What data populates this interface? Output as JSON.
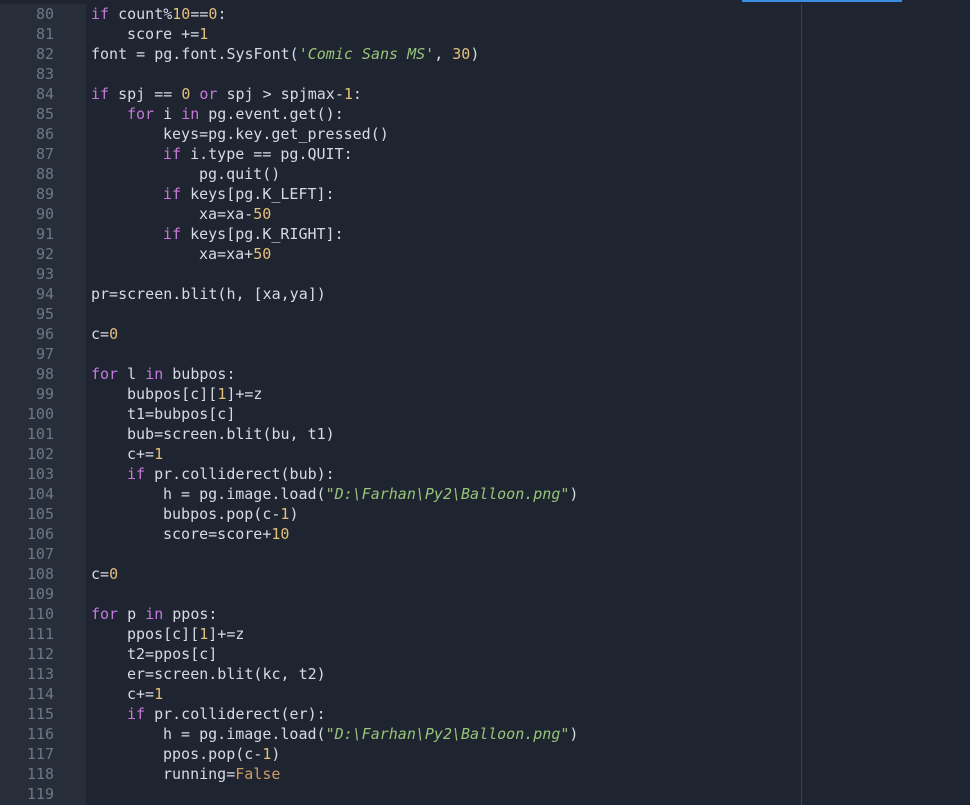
{
  "colors": {
    "background": "#1e2430",
    "gutter": "#272d39",
    "keyword": "#c678dd",
    "number": "#e5c07b",
    "string": "#98c379",
    "text": "#d6dae3",
    "line_number": "#6f7786",
    "accent": "#3a8ee6"
  },
  "editor": {
    "lines": [
      {
        "n": "80",
        "indent": 8,
        "tokens": [
          [
            "kw",
            "if"
          ],
          [
            "t",
            " count%"
          ],
          [
            "num",
            "10"
          ],
          [
            "t",
            "=="
          ],
          [
            "num",
            "0"
          ],
          [
            "t",
            ":"
          ]
        ]
      },
      {
        "n": "81",
        "indent": 12,
        "tokens": [
          [
            "t",
            "score +="
          ],
          [
            "num",
            "1"
          ]
        ]
      },
      {
        "n": "82",
        "indent": 8,
        "tokens": [
          [
            "t",
            "font = pg.font.SysFont("
          ],
          [
            "str",
            "'Comic Sans MS'"
          ],
          [
            "t",
            ", "
          ],
          [
            "num",
            "30"
          ],
          [
            "t",
            ")"
          ]
        ]
      },
      {
        "n": "83",
        "indent": 0,
        "tokens": []
      },
      {
        "n": "84",
        "indent": 8,
        "tokens": [
          [
            "kw",
            "if"
          ],
          [
            "t",
            " spj == "
          ],
          [
            "num",
            "0"
          ],
          [
            "t",
            " "
          ],
          [
            "kw",
            "or"
          ],
          [
            "t",
            " spj > spjmax-"
          ],
          [
            "num",
            "1"
          ],
          [
            "t",
            ":"
          ]
        ]
      },
      {
        "n": "85",
        "indent": 12,
        "tokens": [
          [
            "kw",
            "for"
          ],
          [
            "t",
            " i "
          ],
          [
            "kw",
            "in"
          ],
          [
            "t",
            " pg.event.get():"
          ]
        ]
      },
      {
        "n": "86",
        "indent": 16,
        "tokens": [
          [
            "t",
            "keys=pg.key.get_pressed()"
          ]
        ]
      },
      {
        "n": "87",
        "indent": 16,
        "tokens": [
          [
            "kw",
            "if"
          ],
          [
            "t",
            " i.type == pg.QUIT:"
          ]
        ]
      },
      {
        "n": "88",
        "indent": 20,
        "tokens": [
          [
            "t",
            "pg.quit()"
          ]
        ]
      },
      {
        "n": "89",
        "indent": 16,
        "tokens": [
          [
            "kw",
            "if"
          ],
          [
            "t",
            " keys[pg.K_LEFT]:"
          ]
        ]
      },
      {
        "n": "90",
        "indent": 20,
        "tokens": [
          [
            "t",
            "xa=xa-"
          ],
          [
            "num",
            "50"
          ]
        ]
      },
      {
        "n": "91",
        "indent": 16,
        "tokens": [
          [
            "kw",
            "if"
          ],
          [
            "t",
            " keys[pg.K_RIGHT]:"
          ]
        ]
      },
      {
        "n": "92",
        "indent": 20,
        "tokens": [
          [
            "t",
            "xa=xa+"
          ],
          [
            "num",
            "50"
          ]
        ]
      },
      {
        "n": "93",
        "indent": 0,
        "tokens": []
      },
      {
        "n": "94",
        "indent": 8,
        "tokens": [
          [
            "t",
            "pr=screen.blit(h, [xa,ya])"
          ]
        ]
      },
      {
        "n": "95",
        "indent": 0,
        "tokens": []
      },
      {
        "n": "96",
        "indent": 8,
        "tokens": [
          [
            "t",
            "c="
          ],
          [
            "num",
            "0"
          ]
        ]
      },
      {
        "n": "97",
        "indent": 0,
        "tokens": []
      },
      {
        "n": "98",
        "indent": 8,
        "tokens": [
          [
            "kw",
            "for"
          ],
          [
            "t",
            " l "
          ],
          [
            "kw",
            "in"
          ],
          [
            "t",
            " bubpos:"
          ]
        ]
      },
      {
        "n": "99",
        "indent": 12,
        "tokens": [
          [
            "t",
            "bubpos[c]["
          ],
          [
            "num",
            "1"
          ],
          [
            "t",
            "]+=z"
          ]
        ]
      },
      {
        "n": "100",
        "indent": 12,
        "tokens": [
          [
            "t",
            "t1=bubpos[c]"
          ]
        ]
      },
      {
        "n": "101",
        "indent": 12,
        "tokens": [
          [
            "t",
            "bub=screen.blit(bu, t1)"
          ]
        ]
      },
      {
        "n": "102",
        "indent": 12,
        "tokens": [
          [
            "t",
            "c+="
          ],
          [
            "num",
            "1"
          ]
        ]
      },
      {
        "n": "103",
        "indent": 12,
        "tokens": [
          [
            "kw",
            "if"
          ],
          [
            "t",
            " pr.colliderect(bub):"
          ]
        ]
      },
      {
        "n": "104",
        "indent": 16,
        "tokens": [
          [
            "t",
            "h = pg.image.load("
          ],
          [
            "str",
            "\"D:\\Farhan\\Py2\\Balloon.png\""
          ],
          [
            "t",
            ")"
          ]
        ]
      },
      {
        "n": "105",
        "indent": 16,
        "tokens": [
          [
            "t",
            "bubpos.pop(c-"
          ],
          [
            "num",
            "1"
          ],
          [
            "t",
            ")"
          ]
        ]
      },
      {
        "n": "106",
        "indent": 16,
        "tokens": [
          [
            "t",
            "score=score+"
          ],
          [
            "num",
            "10"
          ]
        ]
      },
      {
        "n": "107",
        "indent": 0,
        "tokens": []
      },
      {
        "n": "108",
        "indent": 8,
        "tokens": [
          [
            "t",
            "c="
          ],
          [
            "num",
            "0"
          ]
        ]
      },
      {
        "n": "109",
        "indent": 0,
        "tokens": []
      },
      {
        "n": "110",
        "indent": 8,
        "tokens": [
          [
            "kw",
            "for"
          ],
          [
            "t",
            " p "
          ],
          [
            "kw",
            "in"
          ],
          [
            "t",
            " ppos:"
          ]
        ]
      },
      {
        "n": "111",
        "indent": 12,
        "tokens": [
          [
            "t",
            "ppos[c]["
          ],
          [
            "num",
            "1"
          ],
          [
            "t",
            "]+=z"
          ]
        ]
      },
      {
        "n": "112",
        "indent": 12,
        "tokens": [
          [
            "t",
            "t2=ppos[c]"
          ]
        ]
      },
      {
        "n": "113",
        "indent": 12,
        "tokens": [
          [
            "t",
            "er=screen.blit(kc, t2)"
          ]
        ]
      },
      {
        "n": "114",
        "indent": 12,
        "tokens": [
          [
            "t",
            "c+="
          ],
          [
            "num",
            "1"
          ]
        ]
      },
      {
        "n": "115",
        "indent": 12,
        "tokens": [
          [
            "kw",
            "if"
          ],
          [
            "t",
            " pr.colliderect(er):"
          ]
        ]
      },
      {
        "n": "116",
        "indent": 16,
        "tokens": [
          [
            "t",
            "h = pg.image.load("
          ],
          [
            "str",
            "\"D:\\Farhan\\Py2\\Balloon.png\""
          ],
          [
            "t",
            ")"
          ]
        ]
      },
      {
        "n": "117",
        "indent": 16,
        "tokens": [
          [
            "t",
            "ppos.pop(c-"
          ],
          [
            "num",
            "1"
          ],
          [
            "t",
            ")"
          ]
        ]
      },
      {
        "n": "118",
        "indent": 16,
        "tokens": [
          [
            "t",
            "running="
          ],
          [
            "bool",
            "False"
          ]
        ]
      },
      {
        "n": "119",
        "indent": 0,
        "tokens": []
      }
    ]
  }
}
